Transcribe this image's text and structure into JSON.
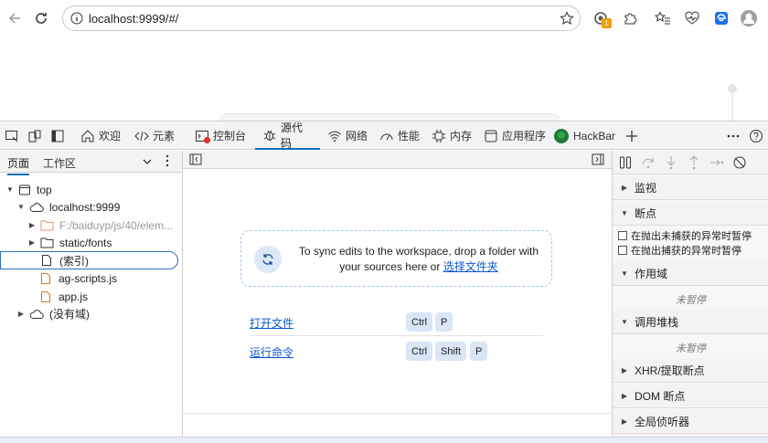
{
  "browser": {
    "url": "localhost:9999/#/",
    "extension_badge": "1"
  },
  "devtools": {
    "tabs": [
      {
        "label": "欢迎",
        "icon": "home-icon"
      },
      {
        "label": "元素",
        "icon": "code-icon"
      },
      {
        "label": "控制台",
        "icon": "console-icon"
      },
      {
        "label": "源代码",
        "icon": "bug-icon"
      },
      {
        "label": "网络",
        "icon": "wifi-icon"
      },
      {
        "label": "性能",
        "icon": "gauge-icon"
      },
      {
        "label": "内存",
        "icon": "chip-icon"
      },
      {
        "label": "应用程序",
        "icon": "app-window-icon"
      },
      {
        "label": "HackBar",
        "icon": "hackbar-logo-icon"
      }
    ],
    "active_tab": "源代码"
  },
  "navigator": {
    "tabs": [
      "页面",
      "工作区"
    ],
    "tree": {
      "top": "top",
      "host": "localhost:9999",
      "folder1": "F:/baiduyp/js/40/elem...",
      "folder2": "static/fonts",
      "index": "(索引)",
      "file1": "ag-scripts.js",
      "file2": "app.js",
      "no_domain": "(没有域)"
    }
  },
  "editor": {
    "sync_text_line1": "To sync edits to the workspace, drop a folder with",
    "sync_text_line2": "your sources here or",
    "sync_link": "选择文件夹",
    "shortcuts": [
      {
        "label": "打开文件",
        "keys": [
          "Ctrl",
          "P"
        ]
      },
      {
        "label": "运行命令",
        "keys": [
          "Ctrl",
          "Shift",
          "P"
        ]
      }
    ]
  },
  "debugger": {
    "sections": {
      "watch": "监视",
      "breakpoints": "断点",
      "pause_uncaught": "在抛出未捕获的异常时暂停",
      "pause_caught": "在抛出捕获的异常时暂停",
      "scope": "作用域",
      "scope_status": "未暂停",
      "callstack": "调用堆栈",
      "callstack_status": "未暂停",
      "xhr": "XHR/提取断点",
      "dom": "DOM 断点",
      "global": "全局侦听器"
    }
  },
  "colors": {
    "accent": "#0f6cbd",
    "link": "#0b57d0",
    "key_bg": "#d8e6f6",
    "dropzone_border": "#a9c7ea",
    "file_icon": "#e8710a"
  }
}
